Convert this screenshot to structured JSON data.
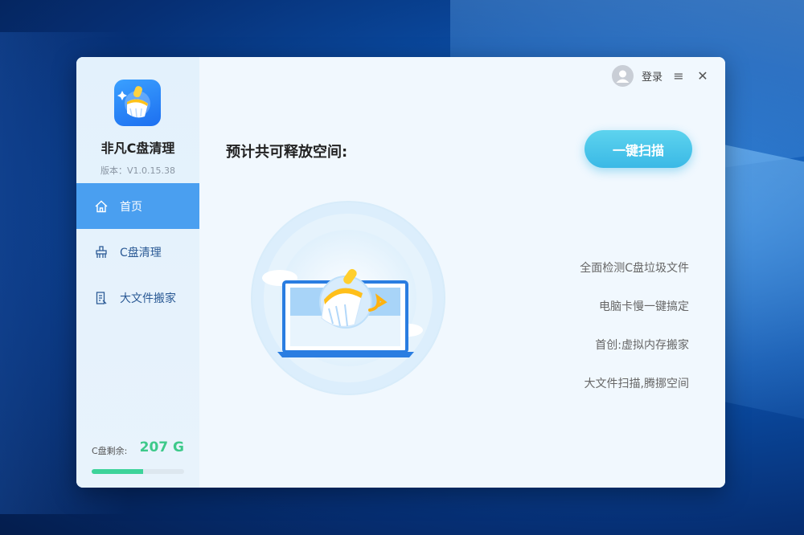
{
  "app": {
    "name": "非凡C盘清理",
    "version": "版本：V1.0.15.38"
  },
  "nav": {
    "items": [
      {
        "label": "首页",
        "icon": "home-icon",
        "active": true
      },
      {
        "label": "C盘清理",
        "icon": "broom-icon",
        "active": false
      },
      {
        "label": "大文件搬家",
        "icon": "document-icon",
        "active": false
      }
    ]
  },
  "disk": {
    "label": "C盘剩余:",
    "value": "207 G",
    "used_fraction": 0.56,
    "bar_color": "#3dd39a"
  },
  "topbar": {
    "login": "登录",
    "menu_icon": "≡",
    "close_icon": "✕"
  },
  "main": {
    "headline": "预计共可释放空间:",
    "scan_button": "一键扫描",
    "features": [
      "全面检测C盘垃圾文件",
      "电脑卡慢一键搞定",
      "首创:虚拟内存搬家",
      "大文件扫描,腾挪空间"
    ]
  },
  "colors": {
    "accent": "#4a9ff0",
    "scan_button": "#3ab9e6",
    "disk_value": "#3dc98a"
  }
}
